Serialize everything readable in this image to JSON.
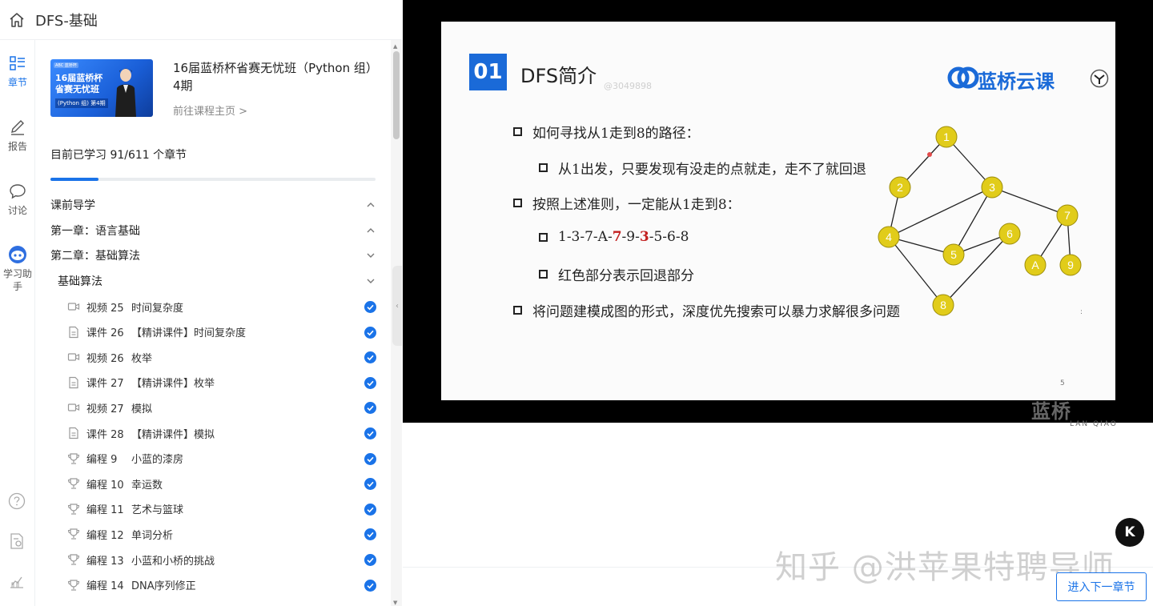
{
  "header": {
    "title": "DFS-基础"
  },
  "rail": {
    "items": [
      {
        "label": "章节"
      },
      {
        "label": "报告"
      },
      {
        "label": "讨论"
      },
      {
        "label": "学习助手"
      }
    ]
  },
  "course": {
    "thumb_tag": "ABC 蓝桥杯",
    "thumb_title": "16届蓝桥杯省赛无忧班",
    "thumb_sub": "(Python 组) 第4期",
    "name": "16届蓝桥杯省赛无忧班（Python 组）4期",
    "link": "前往课程主页 >",
    "progress_text": "目前已学习 91/611 个章节",
    "progress_fraction": 0.149
  },
  "sections": [
    {
      "label": "课前导学",
      "state": "collapsed-up"
    },
    {
      "label": "第一章：语言基础",
      "state": "collapsed-up"
    },
    {
      "label": "第二章：基础算法",
      "state": "expanded"
    }
  ],
  "subsection": {
    "label": "基础算法"
  },
  "lessons": [
    {
      "kind": "视频 25",
      "title": "时间复杂度",
      "icon": "video-icon",
      "done": true
    },
    {
      "kind": "课件 26",
      "title": "【精讲课件】时间复杂度",
      "icon": "document-icon",
      "done": true
    },
    {
      "kind": "视频 26",
      "title": "枚举",
      "icon": "video-icon",
      "done": true
    },
    {
      "kind": "课件 27",
      "title": "【精讲课件】枚举",
      "icon": "document-icon",
      "done": true
    },
    {
      "kind": "视频 27",
      "title": "模拟",
      "icon": "video-icon",
      "done": true
    },
    {
      "kind": "课件 28",
      "title": "【精讲课件】模拟",
      "icon": "document-icon",
      "done": true
    },
    {
      "kind": "编程 9",
      "title": "小蓝的漆房",
      "icon": "trophy-icon",
      "done": true
    },
    {
      "kind": "编程 10",
      "title": "幸运数",
      "icon": "trophy-icon",
      "done": true
    },
    {
      "kind": "编程 11",
      "title": "艺术与篮球",
      "icon": "trophy-icon",
      "done": true
    },
    {
      "kind": "编程 12",
      "title": "单词分析",
      "icon": "trophy-icon",
      "done": true
    },
    {
      "kind": "编程 13",
      "title": "小蓝和小桥的挑战",
      "icon": "trophy-icon",
      "done": true
    },
    {
      "kind": "编程 14",
      "title": "DNA序列修正",
      "icon": "trophy-icon",
      "done": true
    }
  ],
  "slide": {
    "number": "01",
    "title": "DFS简介",
    "watermark": "@3049898",
    "brand": "蓝桥云课",
    "bullets": [
      "如何寻找从1走到8的路径：",
      "从1出发，只要发现有没走的点就走，走不了就回退",
      "按照上述准则，一定能从1走到8：",
      "红色部分表示回退部分",
      "将问题建模成图的形式，深度优先搜索可以暴力求解很多问题"
    ],
    "path_parts": [
      {
        "t": "1-3-7-A-",
        "red": false
      },
      {
        "t": "7",
        "red": true
      },
      {
        "t": "-9-",
        "red": false
      },
      {
        "t": "3",
        "red": true
      },
      {
        "t": "-5-6-8",
        "red": false
      }
    ],
    "page": "5",
    "graph_nodes": [
      "1",
      "2",
      "3",
      "4",
      "5",
      "6",
      "7",
      "A",
      "9",
      "8"
    ]
  },
  "video_watermark": {
    "main": "蓝桥",
    "sub": "LAN QIAO"
  },
  "zhihu_watermark": "知乎 @洪苹果特聘导师",
  "next_button": "进入下一章节",
  "k_button": "K"
}
